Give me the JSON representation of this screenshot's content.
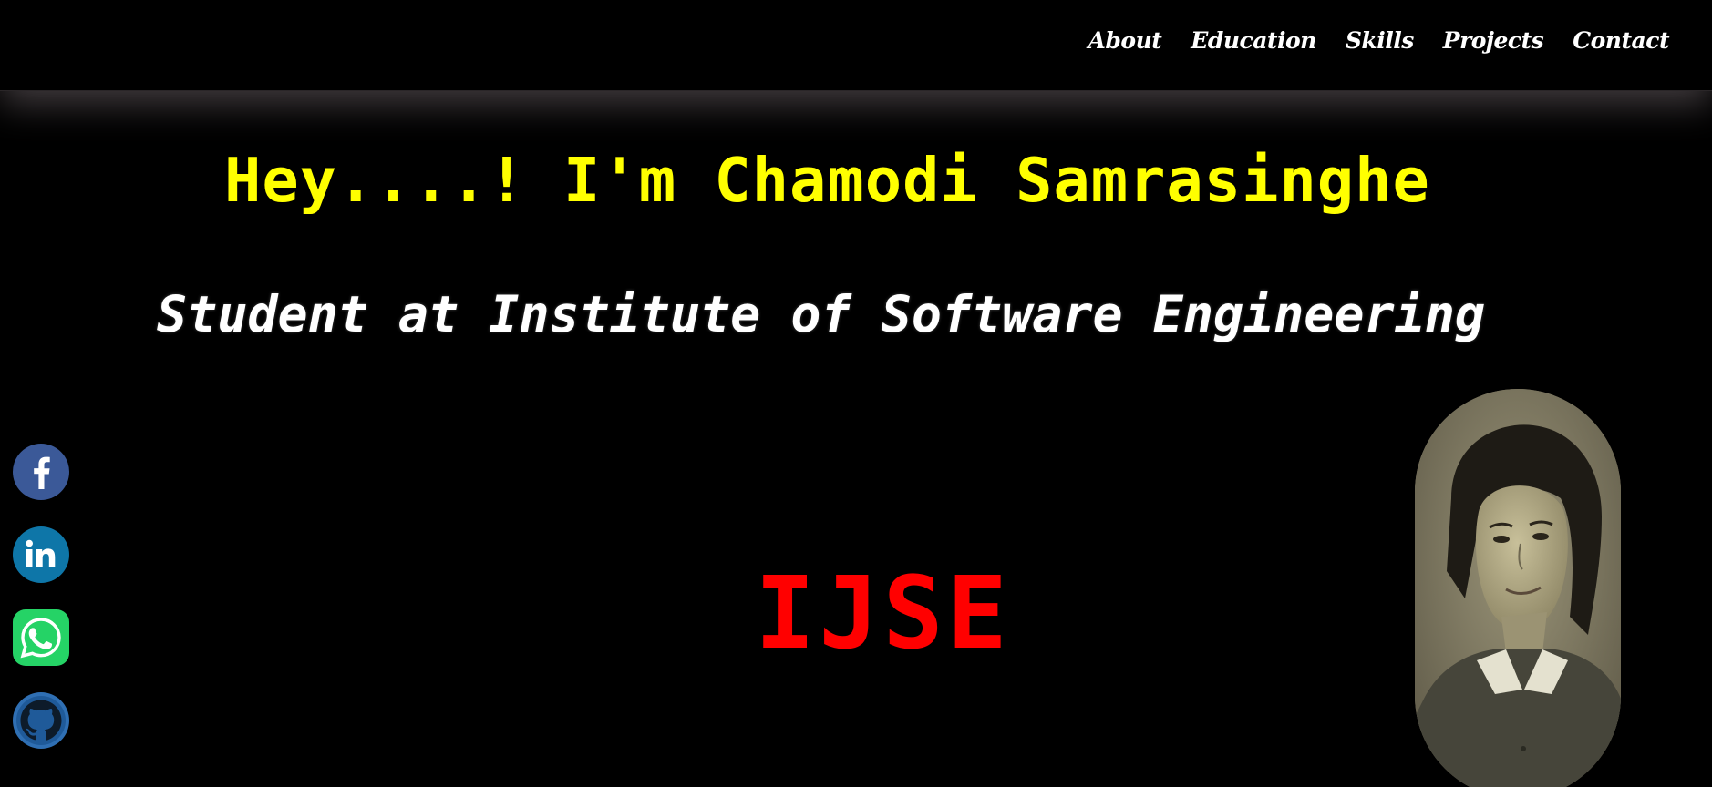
{
  "nav": {
    "items": [
      {
        "label": "About"
      },
      {
        "label": "Education"
      },
      {
        "label": "Skills"
      },
      {
        "label": "Projects"
      },
      {
        "label": "Contact"
      }
    ]
  },
  "hero": {
    "greeting": "Hey....! I'm Chamodi Samrasinghe",
    "subtitle": "Student at Institute of Software Engineering",
    "brand": "IJSE"
  },
  "social": [
    {
      "icon": "facebook-icon",
      "color": "#3b5998"
    },
    {
      "icon": "linkedin-icon",
      "color": "#0e76a8"
    },
    {
      "icon": "whatsapp-icon",
      "color": "#25d366"
    },
    {
      "icon": "github-icon",
      "color": "#2f6fb3"
    }
  ],
  "profile": {
    "photo": "profile-photo"
  },
  "colors": {
    "background": "#000000",
    "greeting": "#ffff00",
    "brand": "#ff0000",
    "text": "#ffffff"
  }
}
